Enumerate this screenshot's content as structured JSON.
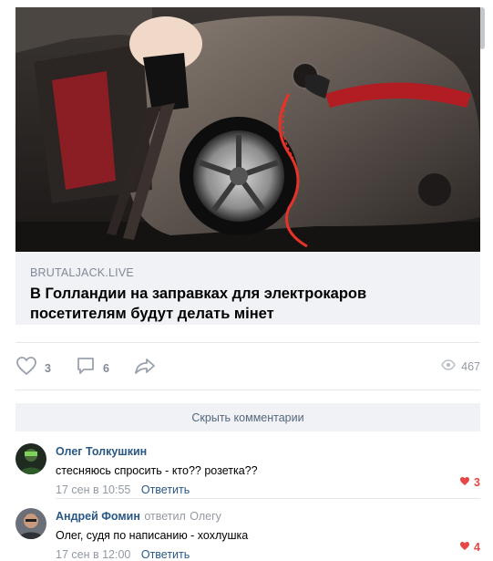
{
  "post": {
    "link": {
      "domain": "BRUTALJACK.LIVE",
      "title": "В Голландии на заправках для электрокаров посетителям будут делать мінет"
    },
    "actions": {
      "likes": "3",
      "comments": "6",
      "views": "467"
    }
  },
  "comments_section": {
    "hide_label": "Скрыть комментарии",
    "items": [
      {
        "author": "Олег Толкушкин",
        "reply_prefix": "",
        "reply_to": "",
        "text": "стесняюсь спросить - кто?? розетка??",
        "time": "17 сен в 10:55",
        "reply_label": "Ответить",
        "likes": "3"
      },
      {
        "author": "Андрей Фомин",
        "reply_prefix": "ответил",
        "reply_to": "Олегу",
        "text": "Олег, судя по написанию - хохлушка",
        "time": "17 сен в 12:00",
        "reply_label": "Ответить",
        "likes": "4"
      }
    ]
  },
  "colors": {
    "link_blue": "#2a5885",
    "muted": "#939aa3",
    "like_red": "#e64646",
    "card_bg": "#f0f2f5"
  }
}
